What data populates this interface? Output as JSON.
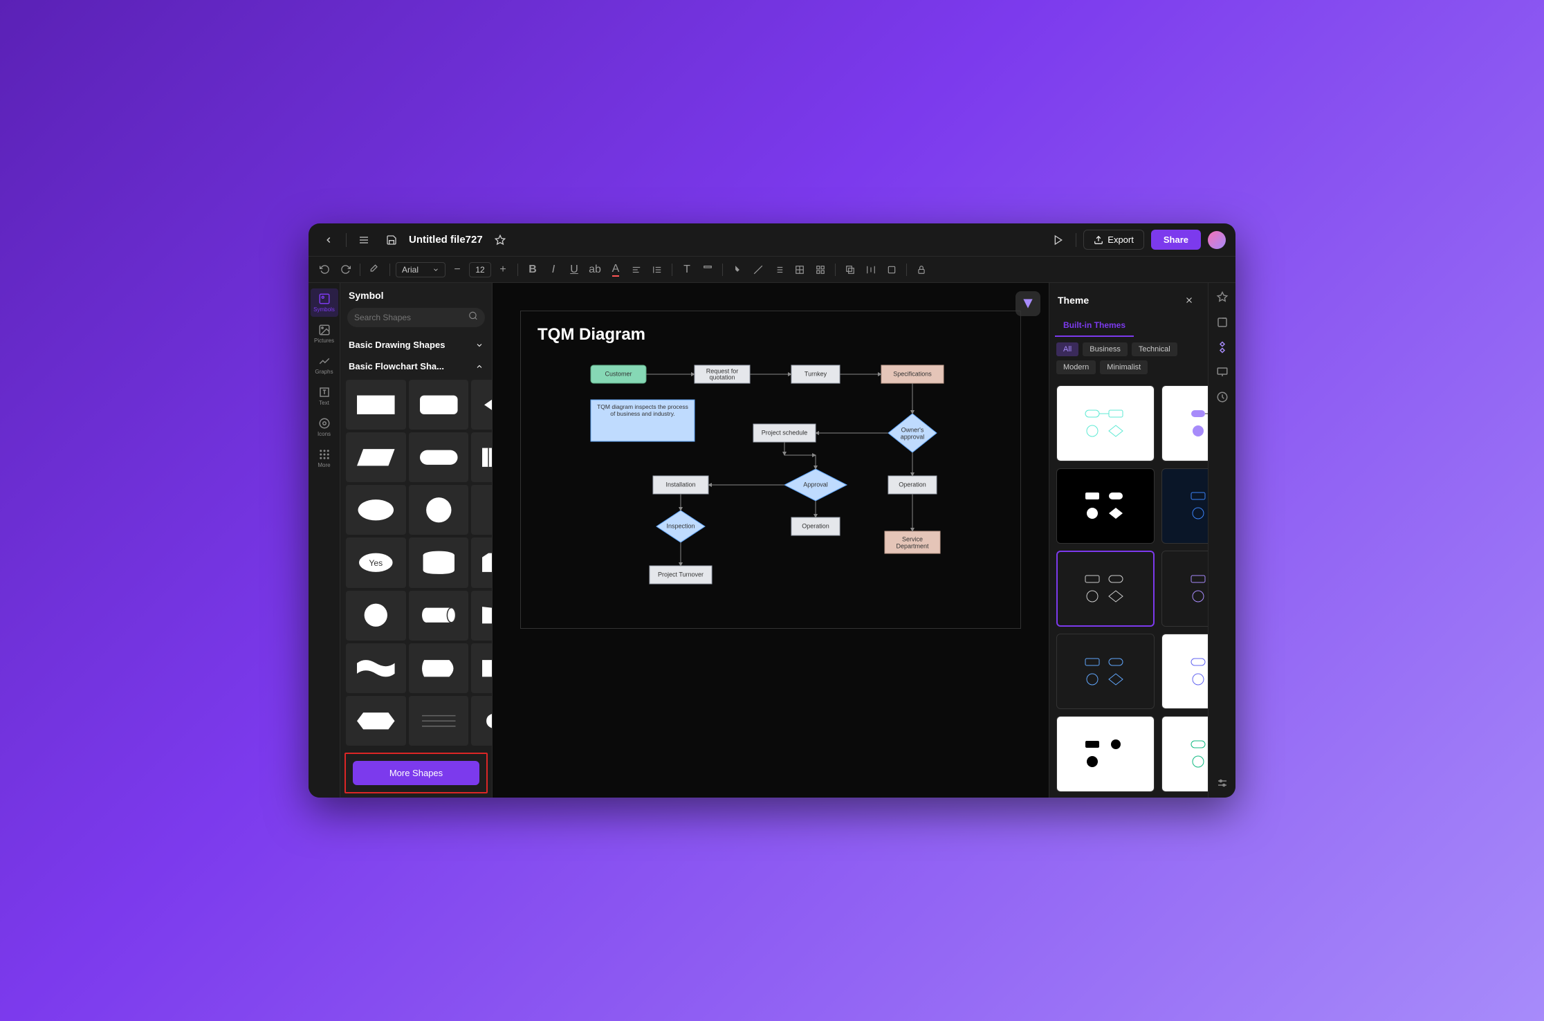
{
  "titlebar": {
    "file_name": "Untitled file727",
    "export_label": "Export",
    "share_label": "Share"
  },
  "toolbar": {
    "font_name": "Arial",
    "font_size": "12"
  },
  "left_rail": [
    {
      "label": "Symbols",
      "icon": "symbols"
    },
    {
      "label": "Pictures",
      "icon": "pictures"
    },
    {
      "label": "Graphs",
      "icon": "graphs"
    },
    {
      "label": "Text",
      "icon": "text"
    },
    {
      "label": "Icons",
      "icon": "icons"
    },
    {
      "label": "More",
      "icon": "more"
    }
  ],
  "symbol_panel": {
    "title": "Symbol",
    "search_placeholder": "Search Shapes",
    "categories": {
      "basic_drawing": "Basic Drawing Shapes",
      "basic_flowchart": "Basic Flowchart Sha..."
    },
    "more_shapes_label": "More Shapes"
  },
  "canvas": {
    "diagram_title": "TQM Diagram",
    "nodes": {
      "customer": "Customer",
      "request": "Request for\nquotation",
      "turnkey": "Turnkey",
      "specs": "Specifications",
      "note": "TQM diagram inspects the process of business and industry.",
      "schedule": "Project schedule",
      "owner_approval": "Owner's approval",
      "installation": "Installation",
      "approval": "Approval",
      "operation1": "Operation",
      "inspection": "Inspection",
      "operation2": "Operation",
      "service": "Service Department",
      "turnover": "Project Turnover"
    }
  },
  "theme_panel": {
    "title": "Theme",
    "tab_label": "Built-in Themes",
    "filters": [
      "All",
      "Business",
      "Technical",
      "Modern",
      "Minimalist"
    ]
  }
}
